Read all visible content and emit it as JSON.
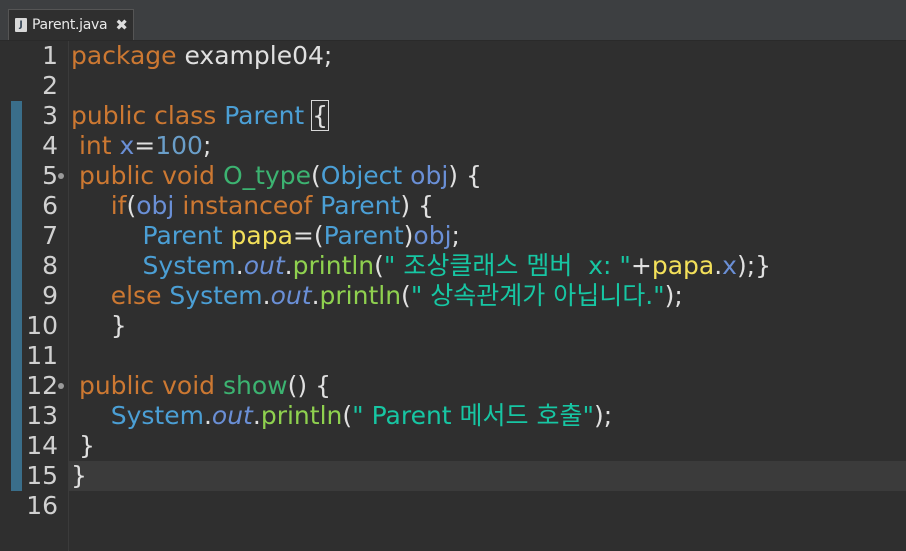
{
  "tab": {
    "title": "Parent.java",
    "close_icon": "close-icon"
  },
  "lines": [
    {
      "n": "1",
      "fold": false,
      "seg": [
        [
          "kw",
          "package"
        ],
        [
          "",
          "&nbsp;example04;"
        ]
      ]
    },
    {
      "n": "2",
      "fold": false,
      "seg": []
    },
    {
      "n": "3",
      "fold": false,
      "seg": [
        [
          "kw",
          "public class"
        ],
        [
          "",
          "&nbsp;"
        ],
        [
          "ty",
          "Parent"
        ],
        [
          "",
          "&nbsp;"
        ],
        [
          "bx",
          "{"
        ]
      ]
    },
    {
      "n": "4",
      "fold": false,
      "seg": [
        [
          "",
          "&nbsp;"
        ],
        [
          "kw",
          "int"
        ],
        [
          "",
          "&nbsp;"
        ],
        [
          "var",
          "x"
        ],
        [
          "",
          "="
        ],
        [
          "num",
          "100"
        ],
        [
          "",
          ";"
        ]
      ]
    },
    {
      "n": "5",
      "fold": true,
      "seg": [
        [
          "",
          "&nbsp;"
        ],
        [
          "kw",
          "public void"
        ],
        [
          "",
          "&nbsp;"
        ],
        [
          "fn",
          "O_type"
        ],
        [
          "",
          "("
        ],
        [
          "ty",
          "Object"
        ],
        [
          "",
          "&nbsp;"
        ],
        [
          "var",
          "obj"
        ],
        [
          "",
          ")&nbsp;{"
        ]
      ]
    },
    {
      "n": "6",
      "fold": false,
      "seg": [
        [
          "",
          "&nbsp;&nbsp;&nbsp;&nbsp;&nbsp;"
        ],
        [
          "kw",
          "if"
        ],
        [
          "",
          "("
        ],
        [
          "var",
          "obj"
        ],
        [
          "",
          "&nbsp;"
        ],
        [
          "kw",
          "instanceof"
        ],
        [
          "",
          "&nbsp;"
        ],
        [
          "ty",
          "Parent"
        ],
        [
          "",
          ")&nbsp;{"
        ]
      ]
    },
    {
      "n": "7",
      "fold": false,
      "seg": [
        [
          "",
          "&nbsp;&nbsp;&nbsp;&nbsp;&nbsp;&nbsp;&nbsp;&nbsp;&nbsp;"
        ],
        [
          "ty",
          "Parent"
        ],
        [
          "",
          "&nbsp;"
        ],
        [
          "loc",
          "papa"
        ],
        [
          "",
          "=("
        ],
        [
          "ty",
          "Parent"
        ],
        [
          "",
          ")"
        ],
        [
          "var",
          "obj"
        ],
        [
          "",
          ";"
        ]
      ]
    },
    {
      "n": "8",
      "fold": false,
      "seg": [
        [
          "",
          "&nbsp;&nbsp;&nbsp;&nbsp;&nbsp;&nbsp;&nbsp;&nbsp;&nbsp;"
        ],
        [
          "ty",
          "System"
        ],
        [
          "",
          "."
        ],
        [
          "fld",
          "out"
        ],
        [
          "",
          "."
        ],
        [
          "mth",
          "println"
        ],
        [
          "",
          "("
        ],
        [
          "str",
          "\"&nbsp;조상클래스&nbsp;멤버&nbsp;&nbsp;x:&nbsp;\""
        ],
        [
          "",
          "+"
        ],
        [
          "loc",
          "papa"
        ],
        [
          "",
          "."
        ],
        [
          "var",
          "x"
        ],
        [
          "",
          ");}"
        ]
      ]
    },
    {
      "n": "9",
      "fold": false,
      "seg": [
        [
          "",
          "&nbsp;&nbsp;&nbsp;&nbsp;&nbsp;"
        ],
        [
          "kw",
          "else"
        ],
        [
          "",
          "&nbsp;"
        ],
        [
          "ty",
          "System"
        ],
        [
          "",
          "."
        ],
        [
          "fld",
          "out"
        ],
        [
          "",
          "."
        ],
        [
          "mth",
          "println"
        ],
        [
          "",
          "("
        ],
        [
          "str",
          "\"&nbsp;상속관계가&nbsp;아닙니다.\""
        ],
        [
          "",
          ");"
        ]
      ]
    },
    {
      "n": "10",
      "fold": false,
      "seg": [
        [
          "",
          "&nbsp;&nbsp;&nbsp;&nbsp;&nbsp;}"
        ]
      ]
    },
    {
      "n": "11",
      "fold": false,
      "seg": []
    },
    {
      "n": "12",
      "fold": true,
      "seg": [
        [
          "",
          "&nbsp;"
        ],
        [
          "kw",
          "public void"
        ],
        [
          "",
          "&nbsp;"
        ],
        [
          "fn",
          "show"
        ],
        [
          "",
          "()&nbsp;{"
        ]
      ]
    },
    {
      "n": "13",
      "fold": false,
      "seg": [
        [
          "",
          "&nbsp;&nbsp;&nbsp;&nbsp;&nbsp;"
        ],
        [
          "ty",
          "System"
        ],
        [
          "",
          "."
        ],
        [
          "fld",
          "out"
        ],
        [
          "",
          "."
        ],
        [
          "mth",
          "println"
        ],
        [
          "",
          "("
        ],
        [
          "str",
          "\"&nbsp;Parent&nbsp;메서드&nbsp;호출\""
        ],
        [
          "",
          ");"
        ]
      ]
    },
    {
      "n": "14",
      "fold": false,
      "seg": [
        [
          "",
          "&nbsp;}"
        ]
      ]
    },
    {
      "n": "15",
      "fold": false,
      "seg": [
        [
          "",
          "}"
        ]
      ]
    },
    {
      "n": "16",
      "fold": false,
      "seg": []
    }
  ]
}
